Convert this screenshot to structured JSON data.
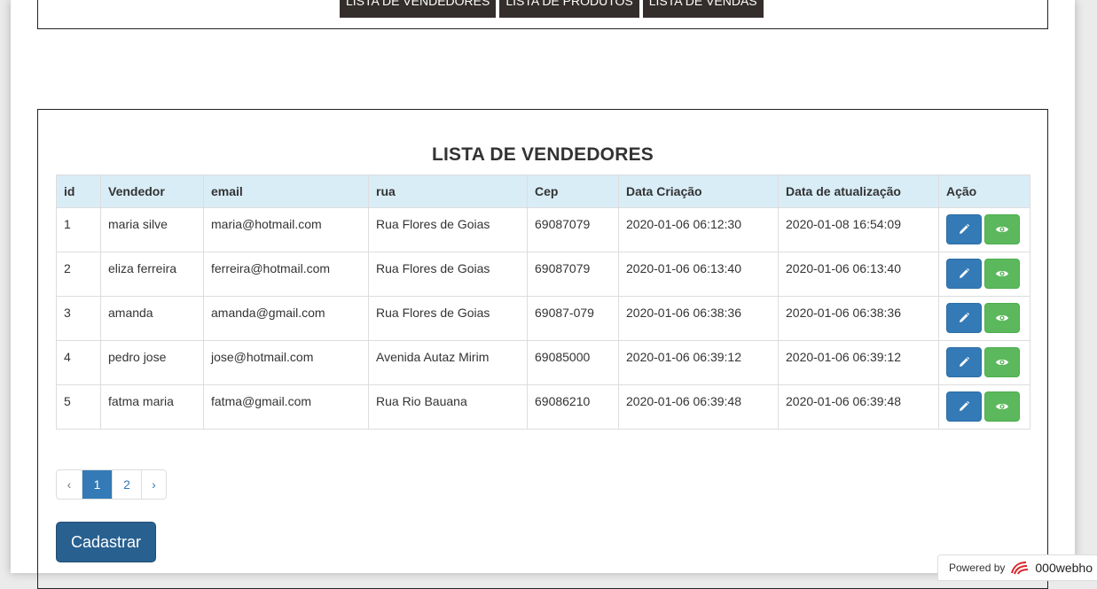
{
  "nav": {
    "items": [
      "LISTA DE VENDEDORES",
      "LISTA DE PRODUTOS",
      "LISTA DE VENDAS"
    ]
  },
  "list": {
    "title": "LISTA DE VENDEDORES",
    "columns": [
      "id",
      "Vendedor",
      "email",
      "rua",
      "Cep",
      "Data Criação",
      "Data de atualização",
      "Ação"
    ],
    "rows": [
      [
        "1",
        "maria silve",
        "maria@hotmail.com",
        "Rua Flores de Goias",
        "69087079",
        "2020-01-06 06:12:30",
        "2020-01-08 16:54:09"
      ],
      [
        "2",
        "eliza ferreira",
        "ferreira@hotmail.com",
        "Rua Flores de Goias",
        "69087079",
        "2020-01-06 06:13:40",
        "2020-01-06 06:13:40"
      ],
      [
        "3",
        "amanda",
        "amanda@gmail.com",
        "Rua Flores de Goias",
        "69087-079",
        "2020-01-06 06:38:36",
        "2020-01-06 06:38:36"
      ],
      [
        "4",
        "pedro jose",
        "jose@hotmail.com",
        "Avenida Autaz Mirim",
        "69085000",
        "2020-01-06 06:39:12",
        "2020-01-06 06:39:12"
      ],
      [
        "5",
        "fatma maria",
        "fatma@gmail.com",
        "Rua Rio Bauana",
        "69086210",
        "2020-01-06 06:39:48",
        "2020-01-06 06:39:48"
      ]
    ],
    "edit_icon": "pencil-icon",
    "view_icon": "eye-icon"
  },
  "pagination": {
    "prev": "‹",
    "pages": [
      "1",
      "2"
    ],
    "active_page": "1",
    "next": "›"
  },
  "cadastrar_label": "Cadastrar",
  "footer": {
    "powered_by": "Powered by",
    "brand": "000webho"
  },
  "colors": {
    "nav_bg": "#332e2c",
    "header_bg": "#d9edf7",
    "edit_btn": "#337ab7",
    "view_btn": "#5cb85c",
    "primary_btn": "#286090"
  }
}
